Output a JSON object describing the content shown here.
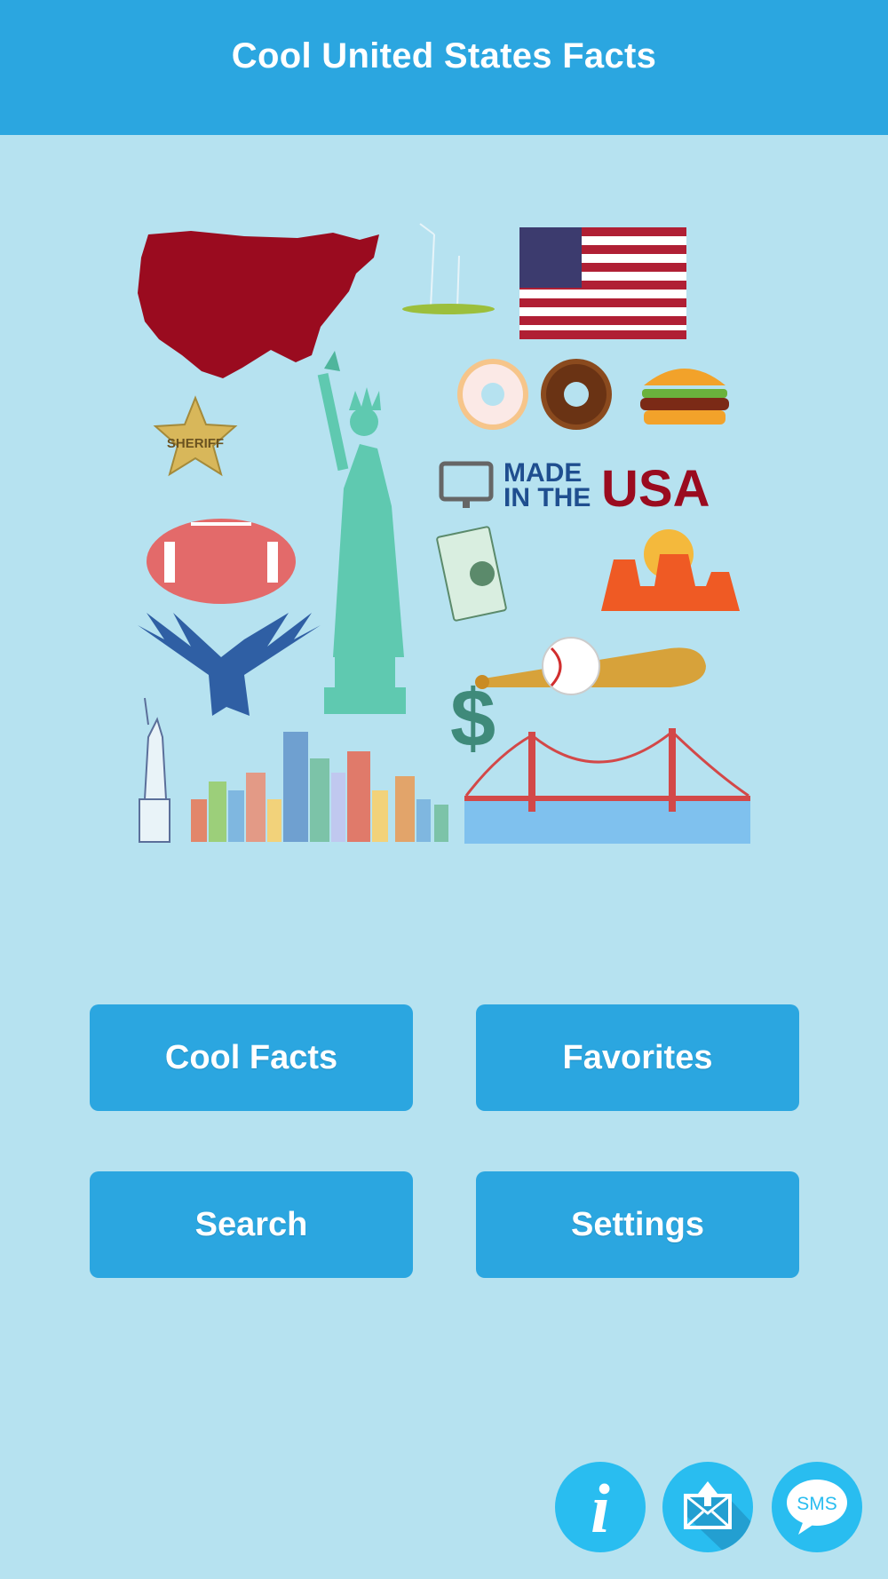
{
  "header": {
    "title": "Cool United States Facts"
  },
  "collage": {
    "sheriff_label": "SHERIFF",
    "made_in_line1": "MADE",
    "made_in_line2": "IN THE",
    "made_in_line3": "USA",
    "dollar": "$"
  },
  "menu": {
    "cool_facts_label": "Cool Facts",
    "favorites_label": "Favorites",
    "search_label": "Search",
    "settings_label": "Settings"
  },
  "footer": {
    "info_glyph": "i",
    "sms_label": "SMS",
    "icons": [
      "info-icon",
      "share-mail-icon",
      "sms-icon"
    ]
  },
  "colors": {
    "header": "#2ba6e0",
    "background": "#b6e2f0",
    "button": "#2ba6e0",
    "round_button": "#29bdf0",
    "usa_red": "#9a0b1f",
    "usa_blue": "#1f4e8f"
  }
}
